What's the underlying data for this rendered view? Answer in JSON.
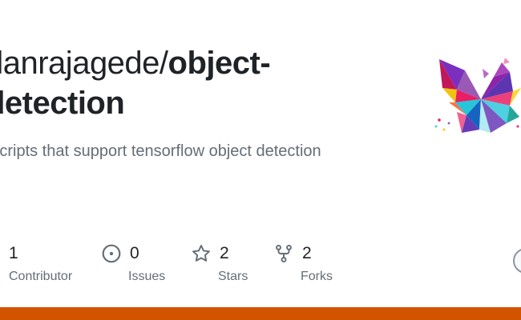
{
  "repo": {
    "owner": "danrajagede/",
    "name": "object-detection",
    "name_line1": "object-",
    "name_line2": "detection",
    "owner_visible": "danrajagede/",
    "description": "Scripts that support tensorflow object detection"
  },
  "stats": {
    "contributors": {
      "count": "1",
      "label": "Contributor",
      "icon": "people-icon"
    },
    "issues": {
      "count": "0",
      "label": "Issues",
      "icon": "issue-opened-icon"
    },
    "stars": {
      "count": "2",
      "label": "Stars",
      "icon": "star-icon"
    },
    "forks": {
      "count": "2",
      "label": "Forks",
      "icon": "repo-forked-icon"
    }
  },
  "colors": {
    "language_bar": "#d35400",
    "muted_text": "#656d76",
    "primary_text": "#1f2328"
  }
}
